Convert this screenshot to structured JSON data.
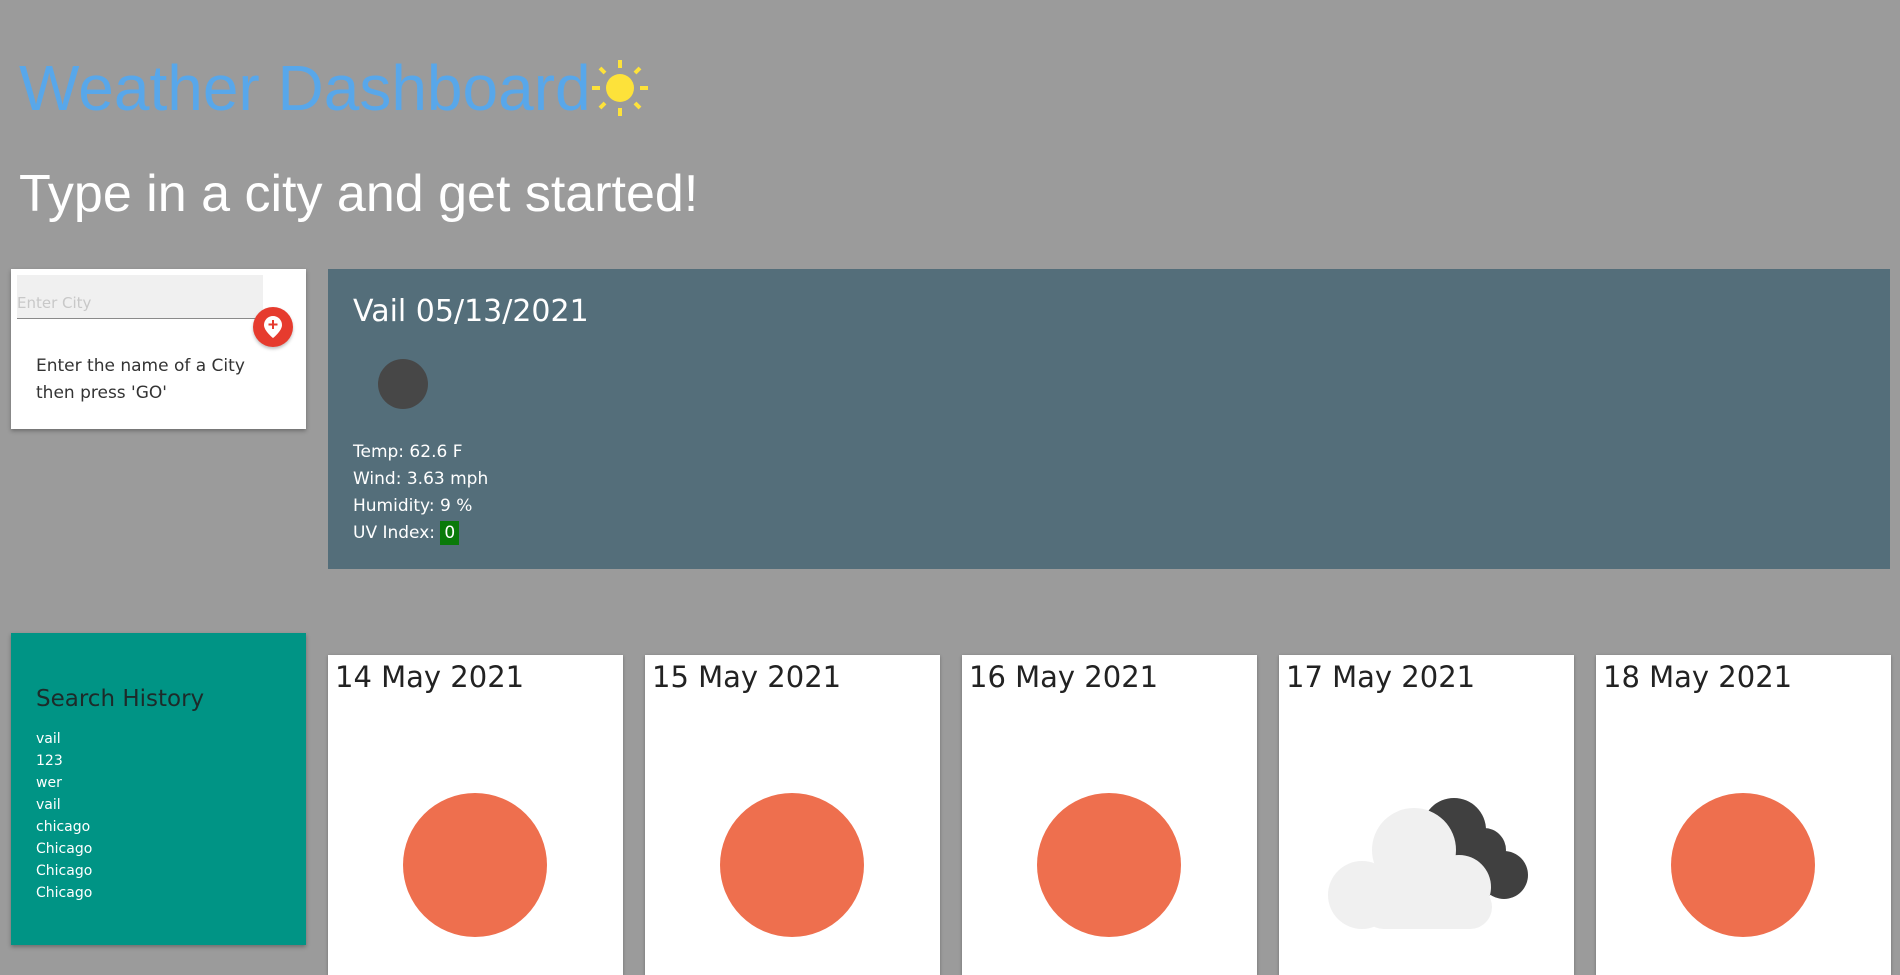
{
  "header": {
    "title": "Weather Dashboard",
    "subtitle": "Type in a city and get started!",
    "title_icon": "sun-icon",
    "colors": {
      "title": "#58a7ea",
      "sun": "#fde23a",
      "background": "#9b9b9b"
    }
  },
  "search": {
    "placeholder": "Enter City",
    "value": "",
    "button_icon": "location-pin-icon",
    "help_text": "Enter the name of a City then press 'GO'",
    "colors": {
      "button": "#e63b2e"
    }
  },
  "current": {
    "city_date": "Vail 05/13/2021",
    "icon": "dark-circle-icon",
    "temp": "Temp: 62.6 F",
    "wind": "Wind: 3.63 mph",
    "humidity": "Humidity: 9 %",
    "uv_label": "UV Index:",
    "uv_value": "0",
    "colors": {
      "panel": "#546e7a",
      "uv_badge": "#0a7a0a"
    }
  },
  "history": {
    "title": "Search History",
    "items": [
      "vail",
      "123",
      "wer",
      "vail",
      "chicago",
      "Chicago",
      "Chicago",
      "Chicago"
    ],
    "colors": {
      "panel": "#009485"
    }
  },
  "forecast": [
    {
      "date": "14 May 2021",
      "icon": "sun-circle-icon"
    },
    {
      "date": "15 May 2021",
      "icon": "sun-circle-icon"
    },
    {
      "date": "16 May 2021",
      "icon": "sun-circle-icon"
    },
    {
      "date": "17 May 2021",
      "icon": "partly-cloudy-icon"
    },
    {
      "date": "18 May 2021",
      "icon": "sun-circle-icon"
    }
  ],
  "forecast_colors": {
    "sun": "#ee6f4e",
    "cloud_light": "#f0f0f0",
    "cloud_dark": "#404040"
  }
}
